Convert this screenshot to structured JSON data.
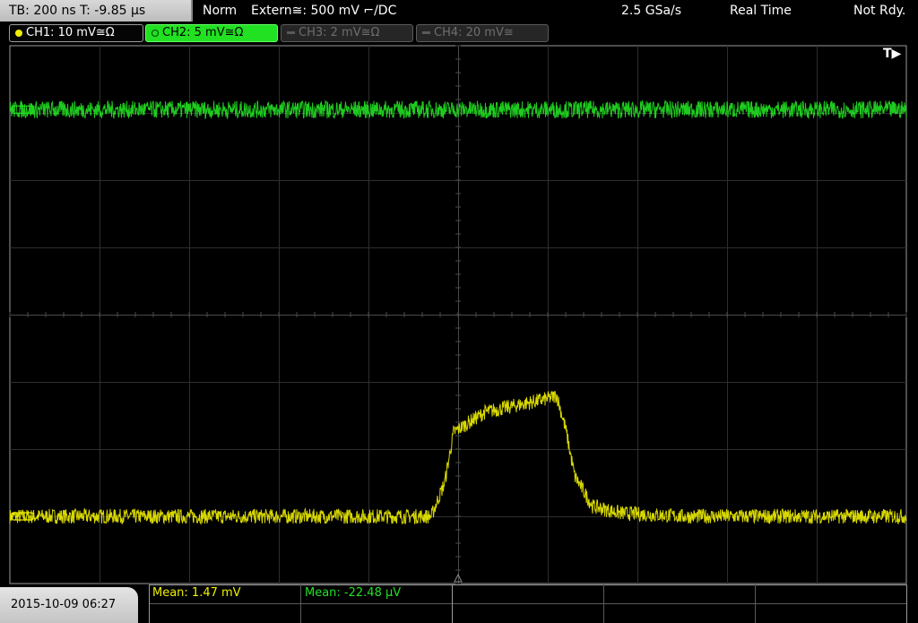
{
  "status_bar": {
    "timebase": "TB: 200 ns   T: -9.85 µs",
    "acq_mode": "Norm",
    "trigger": "Extern≅: 500 mV ⌐/DC",
    "sample_rate": "2.5 GSa/s",
    "mode": "Real Time",
    "state": "Not Rdy."
  },
  "channels": [
    {
      "label": "CH1: 10 mV≅Ω",
      "state": "on",
      "color": "#f0f000"
    },
    {
      "label": "CH2: 5 mV≅Ω",
      "state": "selected",
      "color": "#22e022"
    },
    {
      "label": "CH3: 2 mV≅Ω",
      "state": "off",
      "color": "#6e6e6e"
    },
    {
      "label": "CH4: 20 mV≅",
      "state": "off",
      "color": "#6e6e6e"
    }
  ],
  "trigger_marker": "T▶",
  "datetime": "2015-10-09 06:27",
  "measurements": [
    {
      "text": "Mean: 1.47 mV",
      "color": "#f0f000"
    },
    {
      "text": "Mean: -22.48 µV",
      "color": "#22e022"
    }
  ],
  "chart_data": {
    "type": "line",
    "title": "",
    "xlabel": "",
    "ylabel": "",
    "x_divisions": 10,
    "y_divisions": 8,
    "grid": true,
    "series": [
      {
        "name": "CH1",
        "color": "#f0f000",
        "x": [
          0,
          4.7,
          4.85,
          4.95,
          5.3,
          6.0,
          6.1,
          6.2,
          6.3,
          6.5,
          6.8,
          7.5,
          8.5,
          10
        ],
        "y": [
          -3.0,
          -3.0,
          -2.5,
          -1.75,
          -1.45,
          -1.25,
          -1.2,
          -1.7,
          -2.4,
          -2.85,
          -2.95,
          -3.0,
          -3.0,
          -3.0
        ]
      },
      {
        "name": "CH2",
        "color": "#22e022",
        "x": [
          0,
          10
        ],
        "y": [
          3.05,
          3.05
        ]
      }
    ]
  }
}
